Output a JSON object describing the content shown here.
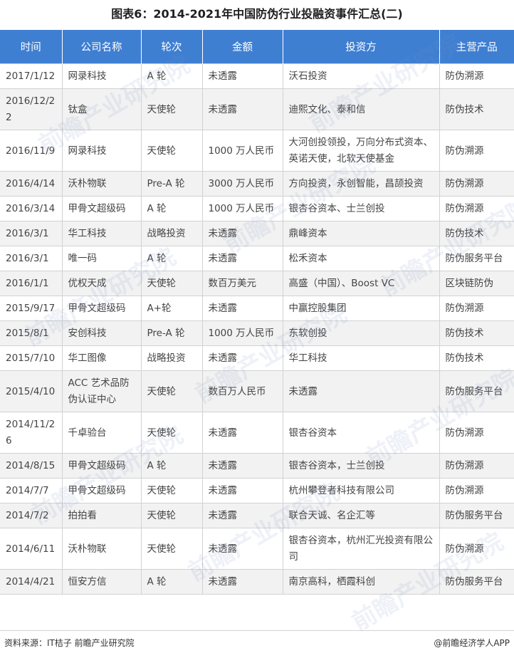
{
  "title": "图表6：2014-2021年中国防伪行业投融资事件汇总(二)",
  "table": {
    "headers": [
      "时间",
      "公司名称",
      "轮次",
      "金额",
      "投资方",
      "主营产品"
    ],
    "rows": [
      [
        "2017/1/12",
        "网录科技",
        "A 轮",
        "未透露",
        "沃石投资",
        "防伪溯源"
      ],
      [
        "2016/12/22",
        "钛盒",
        "天使轮",
        "未透露",
        "迪熙文化、泰和信",
        "防伪技术"
      ],
      [
        "2016/11/9",
        "网录科技",
        "天使轮",
        "1000 万人民币",
        "大河创投领投，万向分布式资本、英诺天使，北软天使基金",
        "防伪溯源"
      ],
      [
        "2016/4/14",
        "沃朴物联",
        "Pre-A 轮",
        "3000 万人民币",
        "方向投资，永创智能，昌颉投资",
        "防伪溯源"
      ],
      [
        "2016/3/14",
        "甲骨文超级码",
        "A 轮",
        "1000 万人民币",
        "银杏谷资本、士兰创投",
        "防伪溯源"
      ],
      [
        "2016/3/1",
        "华工科技",
        "战略投资",
        "未透露",
        "鼎峰资本",
        "防伪技术"
      ],
      [
        "2016/3/1",
        "唯一码",
        "A 轮",
        "未透露",
        "松禾资本",
        "防伪服务平台"
      ],
      [
        "2016/1/1",
        "优权天成",
        "天使轮",
        "数百万美元",
        "高盛（中国）、Boost VC",
        "区块链防伪"
      ],
      [
        "2015/9/17",
        "甲骨文超级码",
        "A+轮",
        "未透露",
        "中赢控股集团",
        "防伪溯源"
      ],
      [
        "2015/8/1",
        "安创科技",
        "Pre-A 轮",
        "1000 万人民币",
        "东软创投",
        "防伪技术"
      ],
      [
        "2015/7/10",
        "华工图像",
        "战略投资",
        "未透露",
        "华工科技",
        "防伪技术"
      ],
      [
        "2015/4/10",
        "ACC 艺术品防伪认证中心",
        "天使轮",
        "数百万人民币",
        "未透露",
        "防伪服务平台"
      ],
      [
        "2014/11/26",
        "千卓验台",
        "天使轮",
        "未透露",
        "银杏谷资本",
        "防伪溯源"
      ],
      [
        "2014/8/15",
        "甲骨文超级码",
        "A 轮",
        "未透露",
        "银杏谷资本，士兰创投",
        "防伪溯源"
      ],
      [
        "2014/7/7",
        "甲骨文超级码",
        "天使轮",
        "未透露",
        "杭州攀登者科技有限公司",
        "防伪溯源"
      ],
      [
        "2014/7/2",
        "拍拍看",
        "天使轮",
        "未透露",
        "联合天诚、名企汇等",
        "防伪服务平台"
      ],
      [
        "2014/6/11",
        "沃朴物联",
        "天使轮",
        "未透露",
        "银杏谷资本，杭州汇光投资有限公司",
        "防伪溯源"
      ],
      [
        "2014/4/21",
        "恒安方信",
        "A 轮",
        "未透露",
        "南京高科，栖霞科创",
        "防伪服务平台"
      ]
    ]
  },
  "watermark_text": "前瞻产业研究院",
  "footer": {
    "source": "资料来源：IT桔子 前瞻产业研究院",
    "brand": "@前瞻经济学人APP"
  },
  "colors": {
    "header_bg": "#3f7fd2",
    "header_text": "#ffffff",
    "stripe": "#f2f2f2"
  }
}
